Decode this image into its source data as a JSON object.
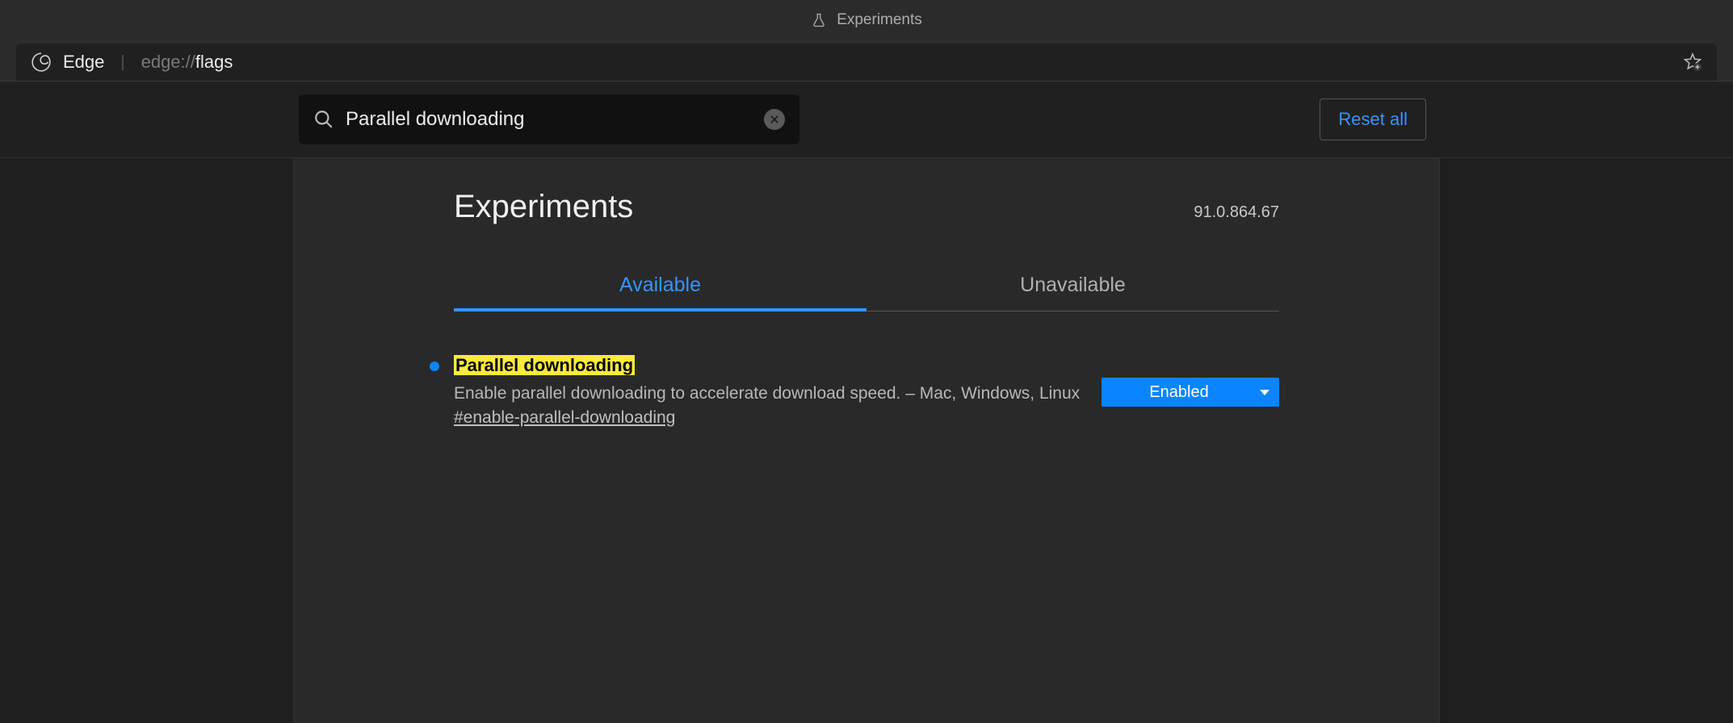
{
  "titlebar": {
    "title": "Experiments"
  },
  "addressbar": {
    "brand": "Edge",
    "url_prefix": "edge://",
    "url_path": "flags"
  },
  "search": {
    "value": "Parallel downloading",
    "reset_label": "Reset all"
  },
  "page": {
    "heading": "Experiments",
    "version": "91.0.864.67"
  },
  "tabs": {
    "available": "Available",
    "unavailable": "Unavailable"
  },
  "flag": {
    "title": "Parallel downloading",
    "description": "Enable parallel downloading to accelerate download speed. – Mac, Windows, Linux",
    "hash": "#enable-parallel-downloading",
    "state": "Enabled"
  }
}
